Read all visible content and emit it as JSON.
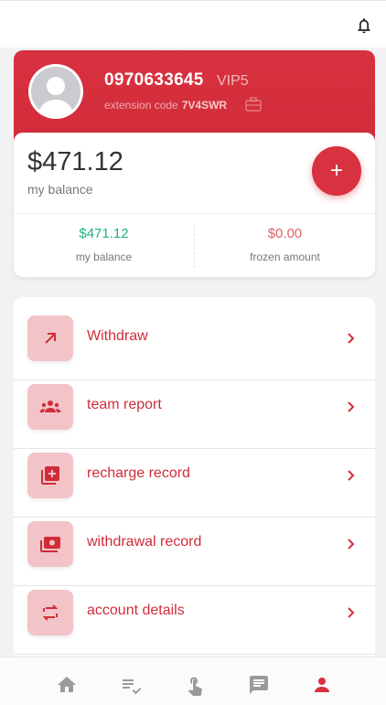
{
  "header": {
    "bell_icon": "bell-icon"
  },
  "profile": {
    "phone": "0970633645",
    "vip": "VIP5",
    "extension_label": "extension code",
    "extension_code": "7V4SWR",
    "copy_icon": "copy-icon",
    "avatar_icon": "user-avatar-icon"
  },
  "balance": {
    "amount": "$471.12",
    "label": "my balance",
    "add_button": "+",
    "stats": [
      {
        "value": "$471.12",
        "label": "my balance"
      },
      {
        "value": "$0.00",
        "label": "frozen amount"
      }
    ]
  },
  "menu": {
    "items": [
      {
        "label": "Withdraw",
        "icon": "arrow-up-right-icon"
      },
      {
        "label": "team report",
        "icon": "group-icon"
      },
      {
        "label": "recharge record",
        "icon": "library-add-icon"
      },
      {
        "label": "withdrawal record",
        "icon": "money-stack-icon"
      },
      {
        "label": "account details",
        "icon": "swap-icon"
      }
    ]
  },
  "tabbar": {
    "tabs": [
      {
        "icon": "home-icon",
        "active": false
      },
      {
        "icon": "list-check-icon",
        "active": false
      },
      {
        "icon": "touch-icon",
        "active": false
      },
      {
        "icon": "chat-icon",
        "active": false
      },
      {
        "icon": "person-icon",
        "active": true
      }
    ]
  },
  "colors": {
    "accent": "#d8313f",
    "green": "#21b27a",
    "soft_red": "#e0606a",
    "icon_bg": "#f2c4c8",
    "inactive": "#9a9a9a"
  }
}
